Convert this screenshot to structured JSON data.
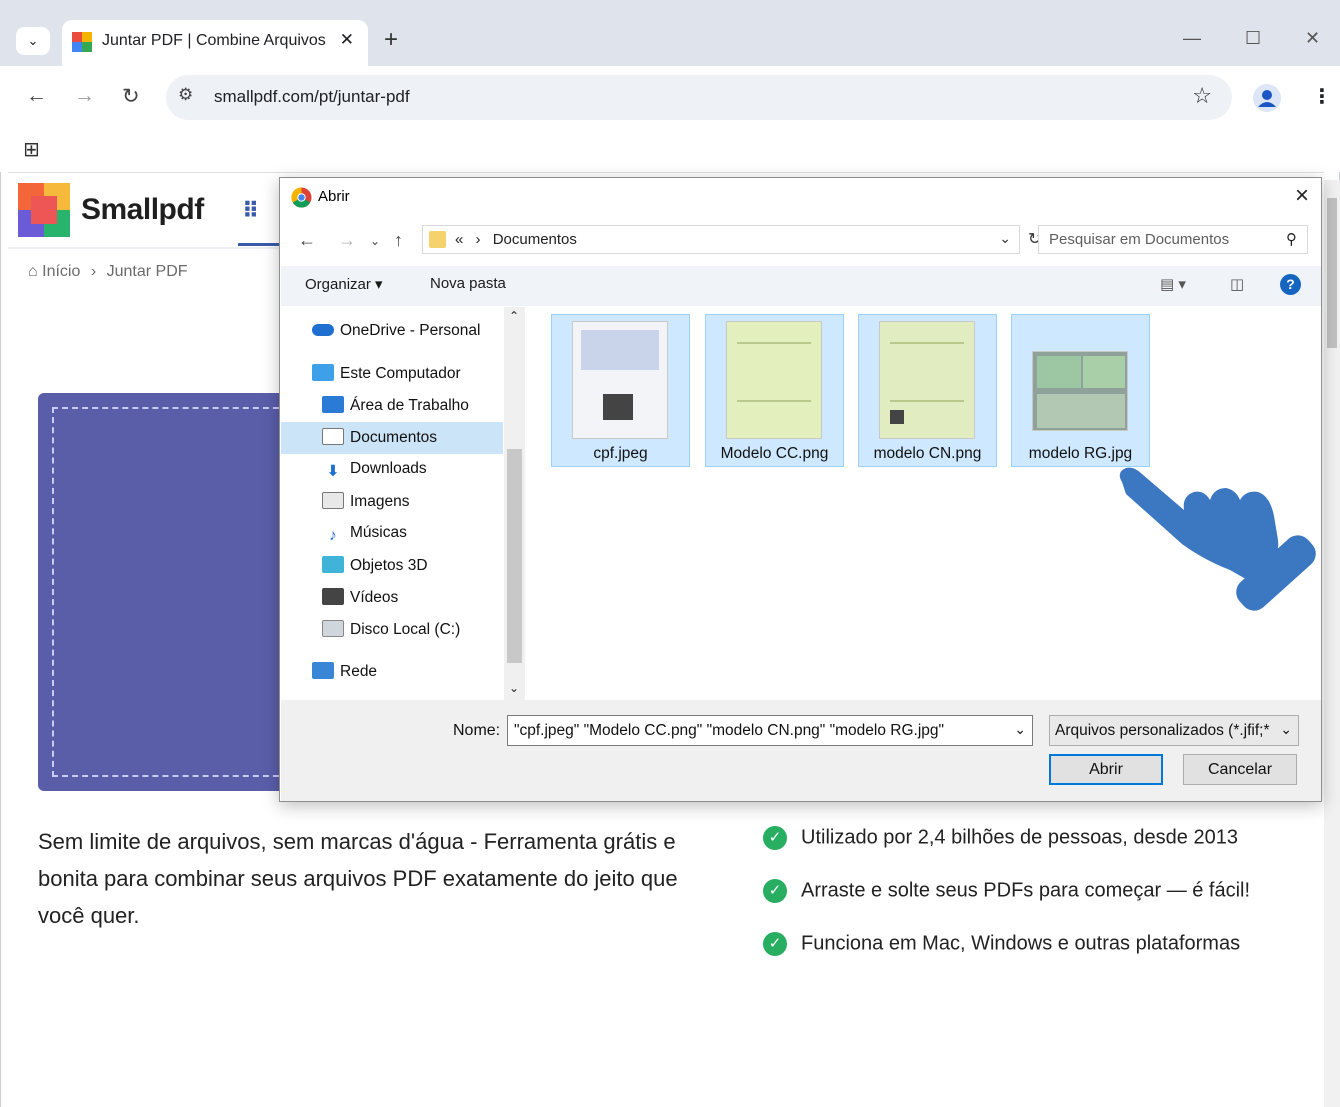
{
  "browser": {
    "tab_title": "Juntar PDF | Combine Arquivos",
    "url": "smallpdf.com/pt/juntar-pdf",
    "tab_close": "✕",
    "new_tab": "+",
    "win_min": "—",
    "win_max": "☐",
    "win_close": "✕"
  },
  "site": {
    "brand": "Smallpdf",
    "breadcrumb_home": "Início",
    "breadcrumb_sep": "›",
    "breadcrumb_current": "Juntar PDF",
    "description": "Sem limite de arquivos, sem marcas d'água - Ferramenta grátis e bonita para combinar seus arquivos PDF exatamente do jeito que você quer.",
    "features": [
      "Utilizado por 2,4 bilhões de pessoas, desde 2013",
      "Arraste e solte seus PDFs para começar — é fácil!",
      "Funciona em Mac, Windows e outras plataformas"
    ]
  },
  "dialog": {
    "title": "Abrir",
    "path_prefix": "«",
    "path_sep": "›",
    "path_current": "Documentos",
    "search_placeholder": "Pesquisar em Documentos",
    "organize": "Organizar ▾",
    "new_folder": "Nova pasta",
    "nav": [
      "OneDrive - Personal",
      "Este Computador",
      "Área de Trabalho",
      "Documentos",
      "Downloads",
      "Imagens",
      "Músicas",
      "Objetos 3D",
      "Vídeos",
      "Disco Local (C:)",
      "Rede"
    ],
    "files": [
      "cpf.jpeg",
      "Modelo CC.png",
      "modelo CN.png",
      "modelo RG.jpg"
    ],
    "name_label": "Nome:",
    "name_value": "\"cpf.jpeg\" \"Modelo CC.png\" \"modelo CN.png\" \"modelo RG.jpg\"",
    "filter_value": "Arquivos personalizados (*.jfif;*",
    "open_btn": "Abrir",
    "cancel_btn": "Cancelar"
  },
  "colors": {
    "accent": "#3a5ba9",
    "dropzone": "#5a5ea9",
    "selection": "#cde8ff",
    "check": "#27ae60",
    "hand": "#3c78c2"
  }
}
